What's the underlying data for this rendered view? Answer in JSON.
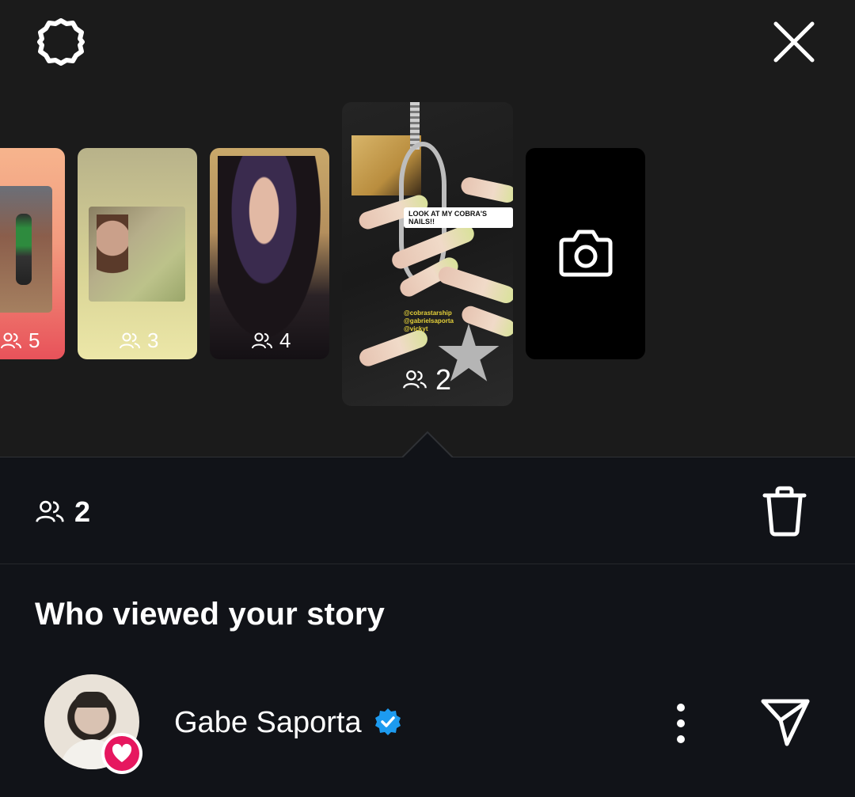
{
  "header": {
    "settings_icon": "settings-icon",
    "close_icon": "close-icon"
  },
  "stories": [
    {
      "views": "5"
    },
    {
      "views": "3"
    },
    {
      "views": "4"
    },
    {
      "views": "2",
      "selected": true,
      "sticker_text": "LOOK AT MY COBRA'S NAILS!!",
      "tags": [
        "@cobrastarship",
        "@gabrielsaporta",
        "@vickyt"
      ]
    }
  ],
  "camera_tile": {
    "icon": "camera-icon"
  },
  "selected_story": {
    "view_count": "2",
    "delete_icon": "trash-icon"
  },
  "viewers_section": {
    "title": "Who viewed your story",
    "viewers": [
      {
        "name": "Gabe Saporta",
        "verified": true,
        "liked": true
      }
    ]
  },
  "colors": {
    "like": "#e6175f",
    "verified": "#1d9bf0",
    "background_top": "#1b1b1b",
    "background_bottom": "#111318"
  }
}
